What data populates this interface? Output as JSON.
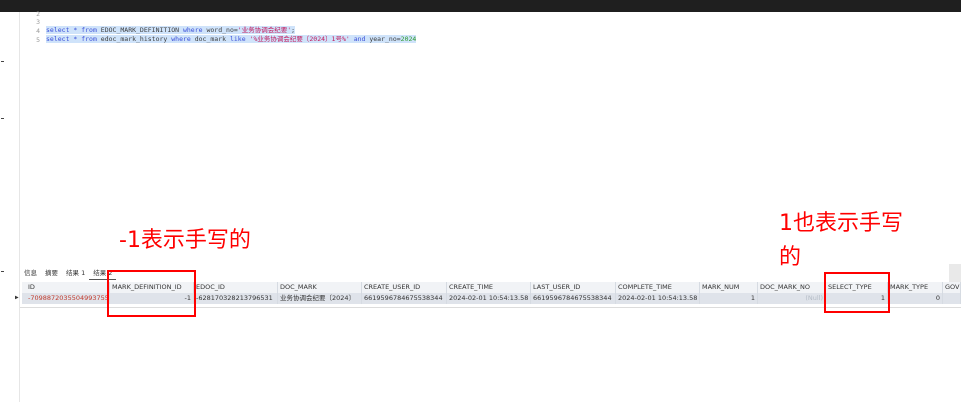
{
  "editor": {
    "line_numbers": [
      "2",
      "3",
      "4",
      "5"
    ],
    "line4": {
      "p1": "select * from ",
      "p2": "EDOC_MARK_DEFINITION ",
      "p3": "where ",
      "p4": "word_no=",
      "p5": "'业务协调会纪要'",
      "p6": ";"
    },
    "line5": {
      "p1": "select * from ",
      "p2": "edoc_mark_history ",
      "p3": "where ",
      "p4": "doc_mark ",
      "p5": "like ",
      "p6": "'%业务协调会纪要〔2024〕1号%'",
      "p7": " and ",
      "p8": "year_no=",
      "p9": "2024"
    }
  },
  "annotations": {
    "left": "-1表示手写的",
    "right_line1": "1也表示手写",
    "right_line2": "的"
  },
  "result_tabs": [
    "信息",
    "摘要",
    "结果 1",
    "结果 2"
  ],
  "grid": {
    "headers": [
      "ID",
      "MARK_DEFINITION_ID",
      "EDOC_ID",
      "DOC_MARK",
      "CREATE_USER_ID",
      "CREATE_TIME",
      "LAST_USER_ID",
      "COMPLETE_TIME",
      "MARK_NUM",
      "DOC_MARK_NO",
      "SELECT_TYPE",
      "MARK_TYPE",
      "GOV"
    ],
    "row": [
      "-7098872035504993755",
      "-1",
      "-628170328213796531",
      "业务协调会纪要〔2024〕",
      "6619596784675538344",
      "2024-02-01 10:54:13.58",
      "6619596784675538344",
      "2024-02-01 10:54:13.58",
      "1",
      "(Null)",
      "1",
      "0",
      ""
    ]
  },
  "colors": {
    "annotation": "#ff0000",
    "selection": "#cfe3fa",
    "keyword": "#3b4fd8",
    "string": "#c2185b",
    "number": "#2e9c2e"
  }
}
